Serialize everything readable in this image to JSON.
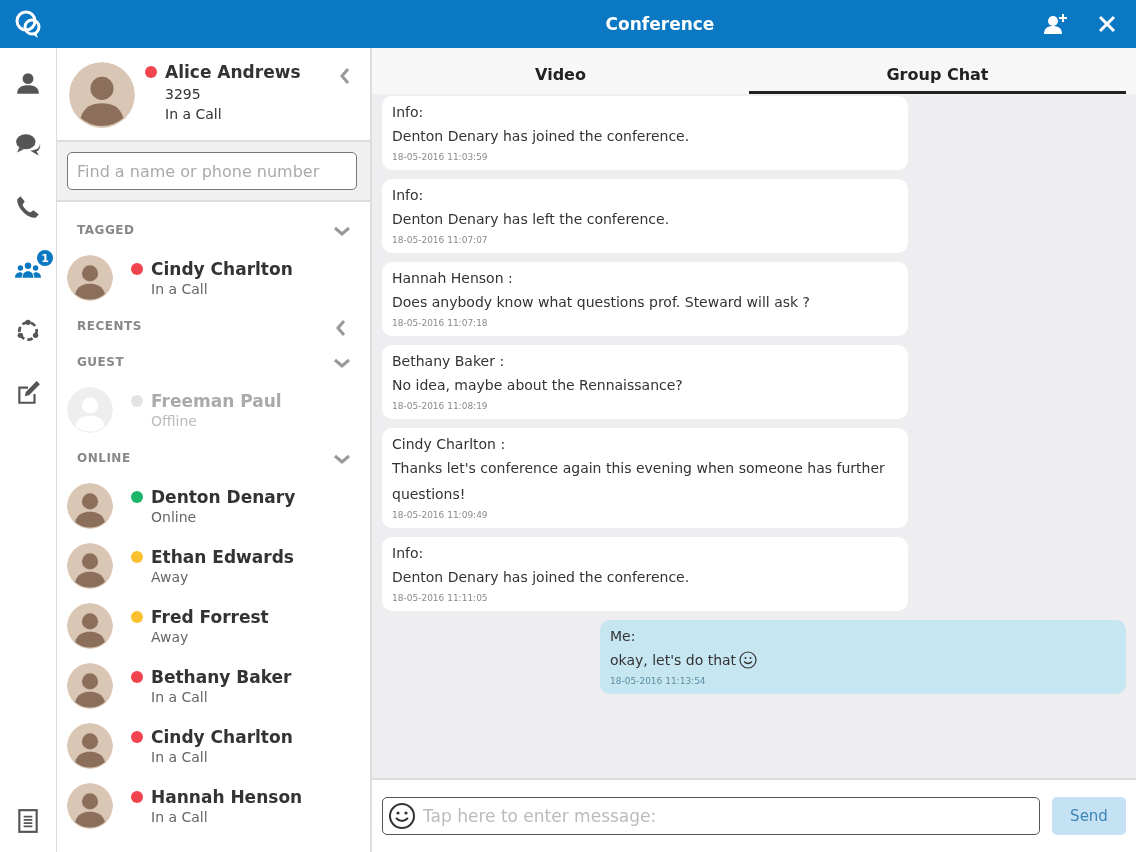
{
  "window": {
    "title": "Conference"
  },
  "rail": [
    {
      "kind": "person",
      "selected": false
    },
    {
      "kind": "chat",
      "selected": false
    },
    {
      "kind": "phone",
      "selected": false
    },
    {
      "kind": "group",
      "selected": true,
      "badge": "1"
    },
    {
      "kind": "ring",
      "selected": false
    },
    {
      "kind": "edit",
      "selected": false
    },
    {
      "kind": "notes",
      "selected": false
    }
  ],
  "profile": {
    "name": "Alice Andrews",
    "number": "3295",
    "status": "In a Call",
    "color": "#f0444e"
  },
  "search": {
    "placeholder": "Find a name or phone number"
  },
  "sections": [
    {
      "title": "TAGGED",
      "expanded": true,
      "contacts": [
        {
          "name": "Cindy Charlton",
          "status": "In a Call",
          "color": "#f0444e",
          "dimmed": false
        }
      ]
    },
    {
      "title": "RECENTS",
      "expanded": false
    },
    {
      "title": "GUEST",
      "expanded": true,
      "contacts": [
        {
          "name": "Freeman Paul",
          "status": "Offline",
          "color": "#e3e3e3",
          "dimmed": true
        }
      ]
    },
    {
      "title": "ONLINE",
      "expanded": true,
      "contacts": [
        {
          "name": "Denton Denary",
          "status": "Online",
          "color": "#1db56a",
          "dimmed": false
        },
        {
          "name": "Ethan Edwards",
          "status": "Away",
          "color": "#fbc02d",
          "dimmed": false
        },
        {
          "name": "Fred Forrest",
          "status": "Away",
          "color": "#fbc02d",
          "dimmed": false
        },
        {
          "name": "Bethany Baker",
          "status": "In a Call",
          "color": "#f0444e",
          "dimmed": false
        },
        {
          "name": "Cindy Charlton",
          "status": "In a Call",
          "color": "#f0444e",
          "dimmed": false
        },
        {
          "name": "Hannah Henson",
          "status": "In a Call",
          "color": "#f0444e",
          "dimmed": false
        }
      ]
    }
  ],
  "tabs": [
    {
      "label": "Video",
      "selected": false
    },
    {
      "label": "Group Chat",
      "selected": true
    }
  ],
  "messages": [
    {
      "sender": "Info:",
      "text": "Denton Denary has joined the conference.",
      "time": "18-05-2016 11:03:59",
      "mine": false,
      "smiley": false
    },
    {
      "sender": "Info:",
      "text": "Denton Denary has left the conference.",
      "time": "18-05-2016 11:07:07",
      "mine": false,
      "smiley": false
    },
    {
      "sender": "Hannah Henson :",
      "text": "Does anybody know what questions prof. Steward will ask ?",
      "time": "18-05-2016 11:07:18",
      "mine": false,
      "smiley": false
    },
    {
      "sender": "Bethany Baker :",
      "text": "No idea, maybe about the Rennaissance?",
      "time": "18-05-2016 11:08:19",
      "mine": false,
      "smiley": false
    },
    {
      "sender": "Cindy Charlton :",
      "text": "Thanks let's conference again this evening when someone has further questions!",
      "time": "18-05-2016 11:09:49",
      "mine": false,
      "smiley": false
    },
    {
      "sender": "Info:",
      "text": "Denton Denary has joined the conference.",
      "time": "18-05-2016 11:11:05",
      "mine": false,
      "smiley": false
    },
    {
      "sender": "Me:",
      "text": "okay, let's do that",
      "time": "18-05-2016 11:13:54",
      "mine": true,
      "smiley": true
    }
  ],
  "composer": {
    "placeholder": "Tap here to enter message:",
    "send": {
      "label": "Send",
      "disabled": true
    }
  }
}
